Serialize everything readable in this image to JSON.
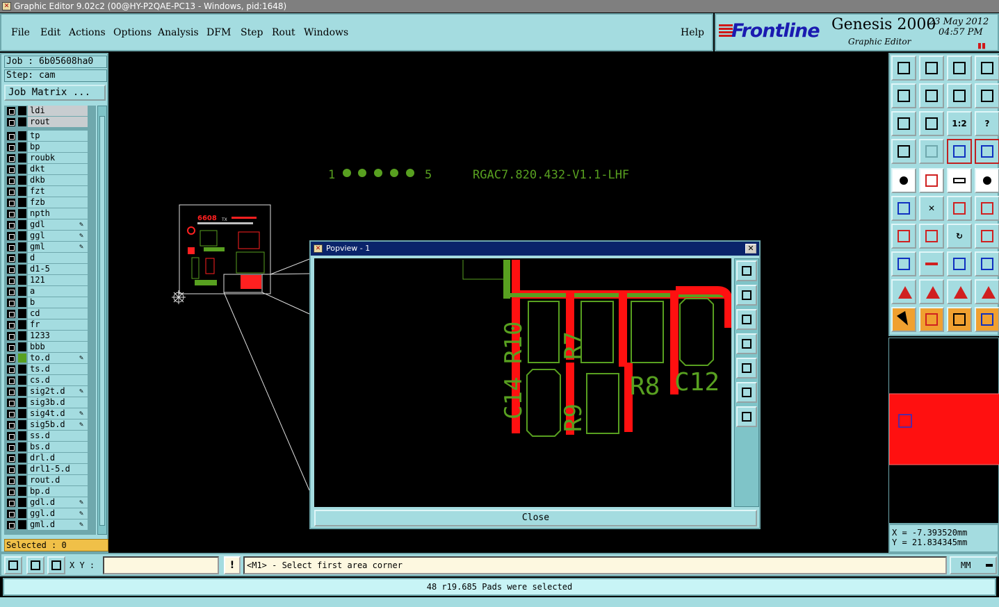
{
  "window": {
    "title": "Graphic Editor 9.02c2 (00@HY-P2QAE-PC13 - Windows, pid:1648)"
  },
  "menu": {
    "items": [
      "File",
      "Edit",
      "Actions",
      "Options",
      "Analysis",
      "DFM",
      "Step",
      "Rout",
      "Windows"
    ],
    "help": "Help"
  },
  "brand": {
    "logo": "Frontline",
    "product": "Genesis 2000",
    "subtitle": "Graphic Editor",
    "date": "23 May 2012",
    "time": "04:57 PM"
  },
  "job": {
    "job_label": "Job : 6b05608ha0",
    "step_label": "Step: cam",
    "matrix_button": "Job Matrix ..."
  },
  "layers": [
    {
      "name": "ldi",
      "grey": true,
      "active": false,
      "edit": false
    },
    {
      "name": "rout",
      "grey": true,
      "active": false,
      "edit": false
    },
    {
      "name": "tp",
      "grey": false,
      "active": false,
      "edit": false,
      "gap": true
    },
    {
      "name": "bp",
      "grey": false,
      "active": false,
      "edit": false
    },
    {
      "name": "roubk",
      "grey": false,
      "active": false,
      "edit": false
    },
    {
      "name": "dkt",
      "grey": false,
      "active": false,
      "edit": false
    },
    {
      "name": "dkb",
      "grey": false,
      "active": false,
      "edit": false
    },
    {
      "name": "fzt",
      "grey": false,
      "active": false,
      "edit": false
    },
    {
      "name": "fzb",
      "grey": false,
      "active": false,
      "edit": false
    },
    {
      "name": "npth",
      "grey": false,
      "active": false,
      "edit": false
    },
    {
      "name": "gdl",
      "grey": false,
      "active": false,
      "edit": true
    },
    {
      "name": "ggl",
      "grey": false,
      "active": false,
      "edit": true
    },
    {
      "name": "gml",
      "grey": false,
      "active": false,
      "edit": true
    },
    {
      "name": "d",
      "grey": false,
      "active": false,
      "edit": false
    },
    {
      "name": "d1-5",
      "grey": false,
      "active": false,
      "edit": false
    },
    {
      "name": "121",
      "grey": false,
      "active": false,
      "edit": false
    },
    {
      "name": "a",
      "grey": false,
      "active": false,
      "edit": false
    },
    {
      "name": "b",
      "grey": false,
      "active": false,
      "edit": false
    },
    {
      "name": "cd",
      "grey": false,
      "active": false,
      "edit": false
    },
    {
      "name": "fr",
      "grey": false,
      "active": false,
      "edit": false
    },
    {
      "name": "1233",
      "grey": false,
      "active": false,
      "edit": false
    },
    {
      "name": "bbb",
      "grey": false,
      "active": false,
      "edit": false
    },
    {
      "name": "to.d",
      "grey": false,
      "active": true,
      "edit": true
    },
    {
      "name": "ts.d",
      "grey": false,
      "active": false,
      "edit": false
    },
    {
      "name": "cs.d",
      "grey": false,
      "active": false,
      "edit": false
    },
    {
      "name": "sig2t.d",
      "grey": false,
      "active": false,
      "edit": true
    },
    {
      "name": "sig3b.d",
      "grey": false,
      "active": false,
      "edit": false
    },
    {
      "name": "sig4t.d",
      "grey": false,
      "active": false,
      "edit": true
    },
    {
      "name": "sig5b.d",
      "grey": false,
      "active": false,
      "edit": true
    },
    {
      "name": "ss.d",
      "grey": false,
      "active": false,
      "edit": false
    },
    {
      "name": "bs.d",
      "grey": false,
      "active": false,
      "edit": false
    },
    {
      "name": "drl.d",
      "grey": false,
      "active": false,
      "edit": false
    },
    {
      "name": "drl1-5.d",
      "grey": false,
      "active": false,
      "edit": false
    },
    {
      "name": "rout.d",
      "grey": false,
      "active": false,
      "edit": false
    },
    {
      "name": "bp.d",
      "grey": false,
      "active": false,
      "edit": false
    },
    {
      "name": "gdl.d",
      "grey": false,
      "active": false,
      "edit": true
    },
    {
      "name": "ggl.d",
      "grey": false,
      "active": false,
      "edit": true
    },
    {
      "name": "gml.d",
      "grey": false,
      "active": false,
      "edit": true
    }
  ],
  "selected_label": "Selected : 0",
  "board": {
    "pin_start": "1",
    "pin_end": "5",
    "part_number": "RGAC7.820.432-V1.1-LHF",
    "thumb_code": "6608",
    "thumb_tx": "TX"
  },
  "popview": {
    "title": "Popview - 1",
    "close_label": "Close",
    "refdes": [
      "C14",
      "R10",
      "R7",
      "R9",
      "R8",
      "C12"
    ]
  },
  "coords": {
    "x": "X = -7.393520mm",
    "y": "Y = 21.834345mm"
  },
  "bottom": {
    "xy_label": "X Y :",
    "xy_value": "",
    "warn_glyph": "!",
    "prompt": "<M1> - Select first area corner",
    "units": "MM"
  },
  "status": "48 r19.685 Pads were selected",
  "colors": {
    "panel": "#a4dce0",
    "copper_green": "#58a020",
    "highlight_red": "#ff1010",
    "selected_yellow": "#f0c048"
  }
}
